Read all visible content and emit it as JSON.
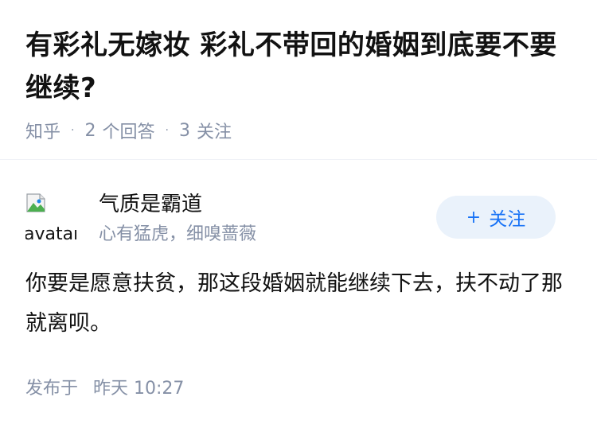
{
  "question": {
    "title": "有彩礼无嫁妆 彩礼不带回的婚姻到底要不要继续?",
    "source": "知乎",
    "answers_count": "2",
    "answers_label": "个回答",
    "followers_count": "3",
    "followers_label": "关注"
  },
  "author": {
    "avatar_alt": "avatar",
    "name": "气质是霸道",
    "bio": "心有猛虎，细嗅蔷薇",
    "follow_plus": "+",
    "follow_label": "关注"
  },
  "answer": {
    "text": "你要是愿意扶贫，那这段婚姻就能继续下去，扶不动了那就离呗。",
    "published_label": "发布于",
    "published_time": "昨天 10:27"
  },
  "colors": {
    "primary": "#1772f6",
    "follow_bg": "#eaf2fb",
    "meta_gray": "#8590a6",
    "text": "#121212"
  }
}
